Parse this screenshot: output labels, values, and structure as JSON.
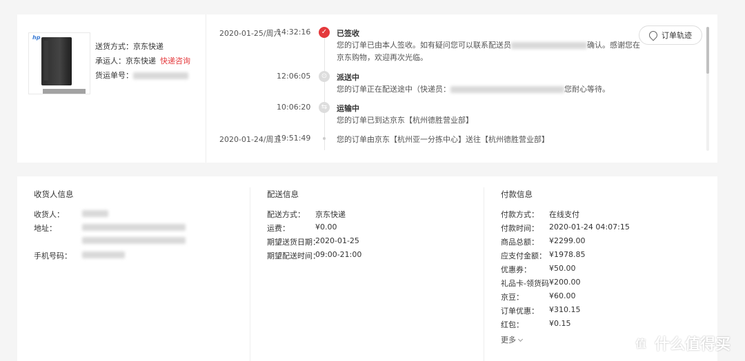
{
  "shipping": {
    "method_label": "送货方式：",
    "method_value": "京东快递",
    "carrier_label": "承运人：",
    "carrier_value": "京东快递",
    "consult_link": "快递咨询",
    "tracking_label": "货运单号："
  },
  "track_button": "订单轨迹",
  "timeline": [
    {
      "date": "2020-01-25/周六",
      "time": "14:32:16",
      "title": "已签收",
      "status": "done",
      "desc_1a": "您的订单已由本人签收。如有疑问您可以联系配送员",
      "desc_1b": "确认。感谢您在",
      "desc_2": "京东购物，欢迎再次光临。"
    },
    {
      "date": "",
      "time": "12:06:05",
      "title": "派送中",
      "status": "pending",
      "desc_1a": "您的订单正在配送途中（快递员：",
      "desc_1b": "您耐心等待。"
    },
    {
      "date": "",
      "time": "10:06:20",
      "title": "运输中",
      "status": "pending",
      "desc": "您的订单已到达京东【杭州德胜营业部】"
    },
    {
      "date": "2020-01-24/周五",
      "time": "19:51:49",
      "title": "",
      "status": "dot",
      "desc": "您的订单由京东【杭州亚一分拣中心】送往【杭州德胜营业部】"
    }
  ],
  "receiver": {
    "heading": "收货人信息",
    "name_label": "收货人：",
    "address_label": "地址：",
    "phone_label": "手机号码："
  },
  "delivery": {
    "heading": "配送信息",
    "rows": [
      {
        "k": "配送方式：",
        "v": "京东快递"
      },
      {
        "k": "运费：",
        "v": "¥0.00"
      },
      {
        "k": "期望送货日期：",
        "v": "2020-01-25"
      },
      {
        "k": "期望配送时间：",
        "v": "09:00-21:00"
      }
    ]
  },
  "payment": {
    "heading": "付款信息",
    "rows": [
      {
        "k": "付款方式：",
        "v": "在线支付"
      },
      {
        "k": "付款时间：",
        "v": "2020-01-24 04:07:15"
      },
      {
        "k": "商品总额：",
        "v": "¥2299.00"
      },
      {
        "k": "应支付金额：",
        "v": "¥1978.85"
      },
      {
        "k": "优惠券：",
        "v": "¥50.00"
      },
      {
        "k": "礼品卡-领货码",
        "v": "¥200.00"
      },
      {
        "k": "京豆：",
        "v": "¥60.00"
      },
      {
        "k": "订单优惠：",
        "v": "¥310.15"
      },
      {
        "k": "红包：",
        "v": "¥0.15"
      }
    ],
    "more": "更多"
  },
  "watermark": {
    "glyph": "值",
    "text": "什么值得买"
  },
  "product_brand": "hp",
  "icons": {
    "done": "check-icon",
    "pending": "truck-icon",
    "track": "location-pin-icon"
  },
  "colors": {
    "accent": "#e4393c"
  }
}
